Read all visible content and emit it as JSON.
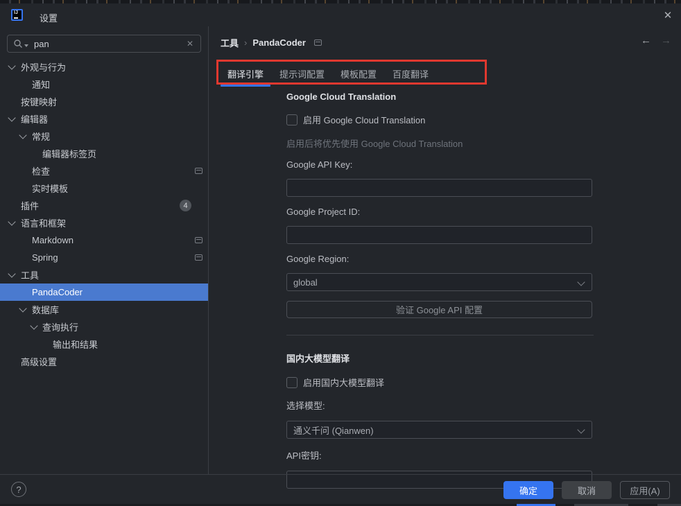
{
  "title_bar": {
    "title": "设置"
  },
  "icons": {
    "close": "✕",
    "clear_search": "✕",
    "back_arrow": "←",
    "forward_arrow": "→",
    "help": "?",
    "breadcrumb_separator": "›"
  },
  "sidebar": {
    "search": {
      "value": "pan"
    },
    "tree": [
      {
        "label": "外观与行为",
        "level": 0,
        "expanded": true
      },
      {
        "label": "通知",
        "level": 1
      },
      {
        "label": "按键映射",
        "level": 0
      },
      {
        "label": "编辑器",
        "level": 0,
        "expanded": true
      },
      {
        "label": "常规",
        "level": 1,
        "expanded": true
      },
      {
        "label": "编辑器标签页",
        "level": 2
      },
      {
        "label": "检查",
        "level": 1,
        "trailing_icon": "window-icon"
      },
      {
        "label": "实时模板",
        "level": 1
      },
      {
        "label": "插件",
        "level": 0,
        "badge": "4"
      },
      {
        "label": "语言和框架",
        "level": 0,
        "expanded": true
      },
      {
        "label": "Markdown",
        "level": 1,
        "trailing_icon": "window-icon"
      },
      {
        "label": "Spring",
        "level": 1,
        "trailing_icon": "window-icon"
      },
      {
        "label": "工具",
        "level": 0,
        "expanded": true
      },
      {
        "label": "PandaCoder",
        "level": 1,
        "selected": true
      },
      {
        "label": "数据库",
        "level": 1,
        "expanded": true
      },
      {
        "label": "查询执行",
        "level": 2,
        "expanded": true
      },
      {
        "label": "输出和结果",
        "level": 3
      },
      {
        "label": "高级设置",
        "level": 0
      }
    ]
  },
  "breadcrumb": {
    "root": "工具",
    "current": "PandaCoder"
  },
  "tabs": [
    {
      "label": "翻译引擎",
      "selected": true
    },
    {
      "label": "提示词配置",
      "selected": false
    },
    {
      "label": "模板配置",
      "selected": false
    },
    {
      "label": "百度翻译",
      "selected": false
    }
  ],
  "content": {
    "google_section": {
      "header": "Google Cloud Translation",
      "enable_label": "启用 Google Cloud Translation",
      "enable_checked": false,
      "hint": "启用后将优先使用 Google Cloud Translation",
      "api_key_label": "Google API Key:",
      "api_key_value": "",
      "project_id_label": "Google Project ID:",
      "project_id_value": "",
      "region_label": "Google Region:",
      "region_value": "global",
      "validate_button": "验证 Google API 配置"
    },
    "domestic_section": {
      "header": "国内大模型翻译",
      "enable_label": "启用国内大模型翻译",
      "enable_checked": false,
      "model_label": "选择模型:",
      "model_value": "通义千问 (Qianwen)",
      "api_secret_label": "API密钥:",
      "api_secret_value": ""
    }
  },
  "footer": {
    "ok_label": "确定",
    "cancel_label": "取消",
    "apply_label": "应用(A)"
  },
  "colors": {
    "accent": "#3574F0",
    "selection_blue": "#4A7ACF",
    "annotation_red": "#E0382F",
    "panel_bg": "#23262B"
  }
}
